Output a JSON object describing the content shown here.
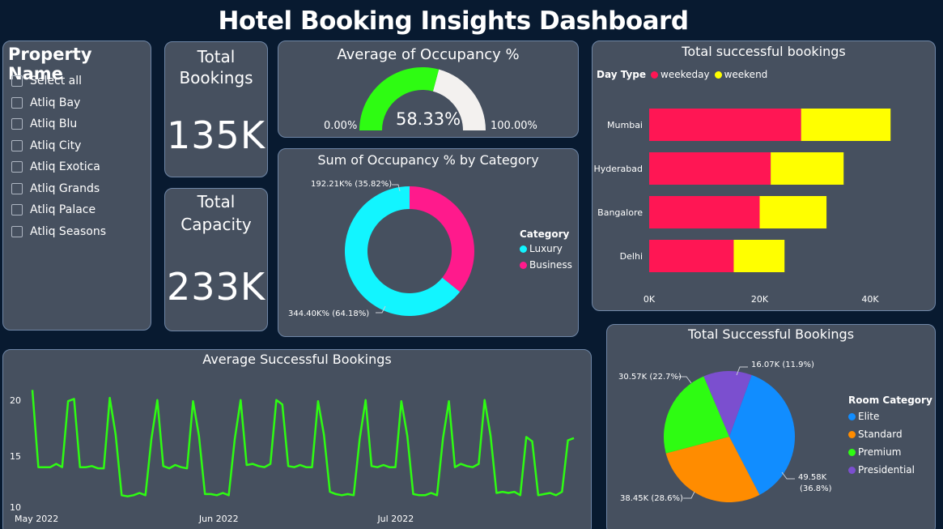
{
  "title": "Hotel Booking Insights Dashboard",
  "slicer": {
    "title": "Property Name",
    "items": [
      "Select all",
      "Atliq Bay",
      "Atliq Blu",
      "Atliq City",
      "Atliq Exotica",
      "Atliq Grands",
      "Atliq Palace",
      "Atliq Seasons"
    ]
  },
  "kpi_bookings": {
    "label_line1": "Total",
    "label_line2": "Bookings",
    "value": "135K"
  },
  "kpi_capacity": {
    "label_line1": "Total",
    "label_line2": "Capacity",
    "value": "233K"
  },
  "colors": {
    "weekday": "#ff1654",
    "weekend": "#ffff00",
    "gauge_fill": "#2efc12",
    "gauge_rest": "#f3f1ef",
    "luxury": "#12f5ff",
    "business": "#ff1a8c",
    "line": "#2efc12",
    "elite": "#118dff",
    "standard": "#ff8c00",
    "premium": "#2efc12",
    "presidential": "#7b4fcf"
  },
  "chart_data": [
    {
      "id": "gauge",
      "type": "gauge",
      "title": "Average of Occupancy %",
      "value": 58.33,
      "min": 0,
      "max": 100,
      "value_label": "58.33%",
      "min_label": "0.00%",
      "max_label": "100.00%"
    },
    {
      "id": "donut",
      "type": "pie",
      "title": "Sum of Occupancy % by Category",
      "legend_title": "Category",
      "slices": [
        {
          "name": "Luxury",
          "value": 344.4,
          "label": "344.40K% (64.18%)"
        },
        {
          "name": "Business",
          "value": 192.21,
          "label": "192.21K% (35.82%)"
        }
      ]
    },
    {
      "id": "hbar",
      "type": "bar",
      "orientation": "horizontal",
      "stacked": true,
      "title": "Total successful bookings",
      "legend_title": "Day Type",
      "categories": [
        "Mumbai",
        "Hyderabad",
        "Bangalore",
        "Delhi"
      ],
      "series": [
        {
          "name": "weekeday",
          "values": [
            27500,
            22000,
            20000,
            15300
          ]
        },
        {
          "name": "weekend",
          "values": [
            16200,
            13200,
            12100,
            9200
          ]
        }
      ],
      "xlim": [
        0,
        45000
      ],
      "ticks": [
        0,
        20000,
        40000
      ],
      "tick_labels": [
        "0K",
        "20K",
        "40K"
      ]
    },
    {
      "id": "line",
      "type": "line",
      "title": "Average Successful Bookings",
      "ylim": [
        10,
        21
      ],
      "y_ticks": [
        10,
        15,
        20
      ],
      "x_tick_labels": [
        "May 2022",
        "Jun 2022",
        "Jul 2022"
      ],
      "x_tick_index": [
        0,
        31,
        61
      ],
      "values": [
        20.9,
        14.0,
        14.0,
        14.0,
        14.3,
        14.0,
        19.9,
        20.1,
        14.0,
        14.0,
        14.1,
        13.9,
        13.9,
        20.2,
        16.9,
        11.5,
        11.4,
        11.5,
        11.7,
        11.5,
        16.5,
        20.0,
        14.1,
        13.9,
        14.2,
        14.0,
        13.9,
        19.9,
        16.8,
        11.6,
        11.6,
        11.5,
        11.7,
        11.5,
        16.5,
        20.0,
        14.2,
        14.3,
        14.1,
        14.0,
        14.3,
        20.0,
        19.6,
        14.1,
        14.0,
        14.2,
        14.0,
        14.0,
        19.9,
        16.9,
        11.8,
        11.6,
        11.5,
        11.6,
        11.5,
        16.5,
        20.0,
        14.1,
        14.0,
        14.2,
        14.0,
        14.0,
        19.9,
        16.8,
        11.6,
        11.5,
        11.5,
        11.7,
        11.5,
        16.6,
        19.9,
        14.0,
        14.3,
        14.1,
        14.0,
        14.3,
        20.0,
        16.8,
        11.7,
        11.8,
        11.7,
        11.8,
        11.5,
        16.7,
        16.3,
        11.5,
        11.6,
        11.7,
        11.5,
        11.8,
        16.4,
        16.6
      ]
    },
    {
      "id": "pie",
      "type": "pie",
      "title": "Total Successful Bookings",
      "legend_title": "Room Category",
      "slices": [
        {
          "name": "Elite",
          "value": 49.58,
          "label_line1": "49.58K",
          "label_line2": "(36.8%)"
        },
        {
          "name": "Standard",
          "value": 38.45,
          "label": "38.45K (28.6%)"
        },
        {
          "name": "Premium",
          "value": 30.57,
          "label": "30.57K (22.7%)"
        },
        {
          "name": "Presidential",
          "value": 16.07,
          "label": "16.07K (11.9%)"
        }
      ]
    }
  ]
}
